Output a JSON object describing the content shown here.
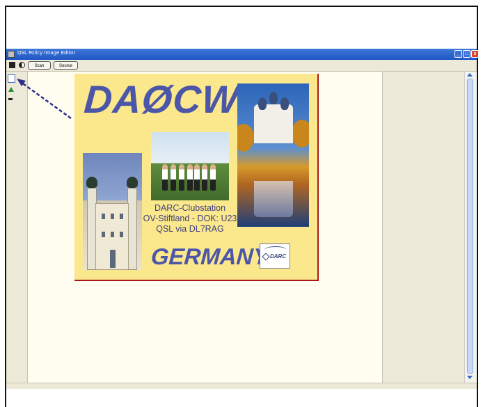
{
  "window": {
    "title": "QSL Policy Image Editor",
    "min_glyph": "_",
    "max_glyph": "□",
    "close_glyph": "x"
  },
  "toolbar": {
    "scan_label": "Scan",
    "source_label": "Source"
  },
  "qsl_card": {
    "callsign": "DAØCW",
    "text_lines": [
      "DARC-Clubstation",
      "OV-Stiftland - DOK: U23",
      "QSL via DL7RAG"
    ],
    "country": "GERMANY",
    "logo_text": "DARC"
  },
  "colors": {
    "titlebar": "#1f56c5",
    "card_background": "#fbe88c",
    "callsign_blue": "#4b56a8",
    "card_border": "#a81818",
    "annotation_arrow": "#2c2f8a"
  },
  "icons": [
    "save-icon",
    "contrast-icon",
    "select-tool-icon",
    "rotate-tool-icon",
    "minus-tool-icon"
  ]
}
